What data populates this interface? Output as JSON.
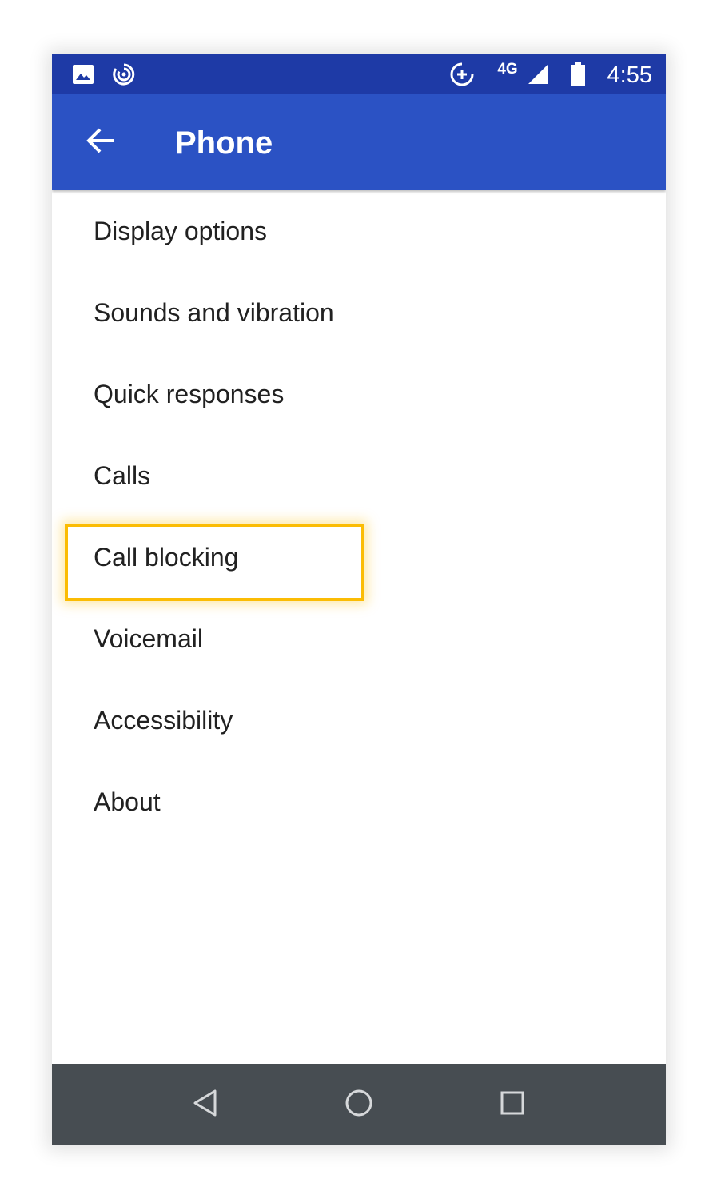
{
  "status_bar": {
    "time": "4:55",
    "network": "4G",
    "icons": [
      "image-icon",
      "data-saver-icon",
      "circle-plus-icon",
      "signal-icon",
      "battery-icon"
    ]
  },
  "app_bar": {
    "title": "Phone",
    "back_icon": "arrow-back-icon"
  },
  "menu": {
    "items": [
      {
        "label": "Display options"
      },
      {
        "label": "Sounds and vibration"
      },
      {
        "label": "Quick responses"
      },
      {
        "label": "Calls"
      },
      {
        "label": "Call blocking",
        "highlighted": true
      },
      {
        "label": "Voicemail"
      },
      {
        "label": "Accessibility"
      },
      {
        "label": "About"
      }
    ]
  },
  "nav_bar": {
    "icons": [
      "back-triangle-icon",
      "home-circle-icon",
      "recents-square-icon"
    ]
  },
  "colors": {
    "status_bar": "#1e3aa6",
    "app_bar": "#2b52c4",
    "highlight": "#fbbc04",
    "nav_bar": "#474d52",
    "text": "#212121"
  }
}
